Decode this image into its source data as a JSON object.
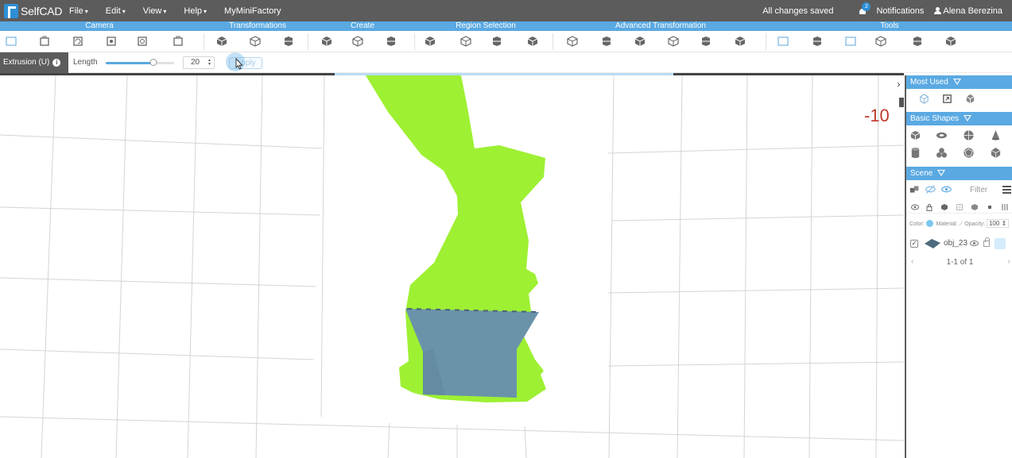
{
  "app": {
    "name": "SelfCAD",
    "menus": [
      "File",
      "Edit",
      "View",
      "Help"
    ],
    "link": "MyMiniFactory",
    "saved_status": "All changes saved",
    "notifications_label": "Notifications",
    "notifications_count": "2",
    "user_name": "Alena Berezina"
  },
  "categories": [
    "Camera",
    "Transformations",
    "Create",
    "Region Selection",
    "Advanced Transformation",
    "Tools"
  ],
  "toolbar_icons": [
    "page-icon",
    "zoom-fit-icon",
    "camera-front-icon",
    "camera-rotate-icon",
    "camera-settings-icon",
    "camera-reset-icon",
    "move-icon",
    "scale-icon",
    "rotate-icon",
    "create-box-icon",
    "create-cube-icon",
    "create-shape-icon",
    "select-box-icon",
    "select-face-icon",
    "select-edge-icon",
    "select-vertex-icon",
    "extrude-icon",
    "grid-cube-icon",
    "bevel-icon",
    "spike-icon",
    "twist-icon",
    "slice-icon",
    "stitch-icon",
    "sculpt-icon",
    "wire-cube-icon",
    "repair-icon",
    "mesh-cube-icon",
    "utilities-icon"
  ],
  "options": {
    "mode_label": "Extrusion (U)",
    "length_label": "Length",
    "length_value": "20",
    "slider_fraction": 0.7,
    "apply_label": "Apply"
  },
  "viewport": {
    "coordinate_readout": "-10",
    "progress_start": 0.37,
    "progress_end": 0.745
  },
  "panel": {
    "most_used_title": "Most Used",
    "basic_shapes_title": "Basic Shapes",
    "scene_title": "Scene",
    "filter_placeholder": "Filter",
    "material_row": {
      "color_label": "Color:",
      "material_label": "Material:",
      "opacity_label": "Opacity:",
      "opacity_value": "100"
    },
    "object": {
      "name": "obj_23",
      "checked": true
    },
    "pagination": "1-1 of 1"
  },
  "colors": {
    "menu_bg": "#5c5c5c",
    "accent": "#5aa9e2",
    "bunny": "#9ef033",
    "extrusion": "#6a93aa",
    "readout": "#c0392b"
  }
}
